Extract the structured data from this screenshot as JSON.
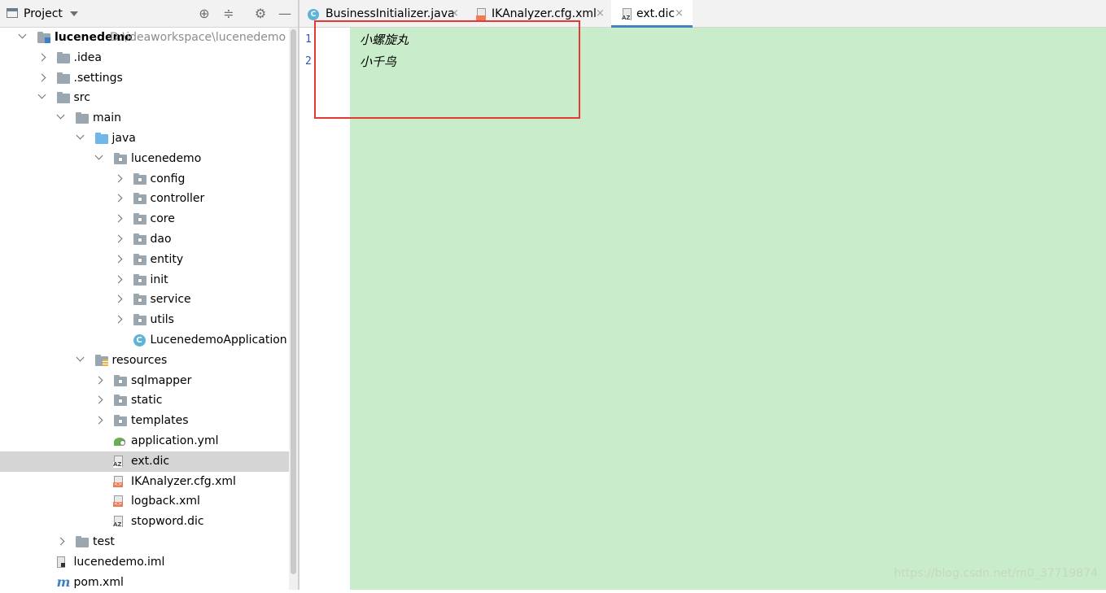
{
  "project_panel": {
    "title": "Project",
    "tree": [
      {
        "label": "lucenedemo",
        "path": "D:\\ideaworkspace\\lucenedemo",
        "depth": 0,
        "arrow": "down",
        "icon": "module-icon",
        "bold": true
      },
      {
        "label": ".idea",
        "depth": 1,
        "arrow": "right",
        "icon": "folder-icon"
      },
      {
        "label": ".settings",
        "depth": 1,
        "arrow": "right",
        "icon": "folder-icon"
      },
      {
        "label": "src",
        "depth": 1,
        "arrow": "down",
        "icon": "folder-icon"
      },
      {
        "label": "main",
        "depth": 2,
        "arrow": "down",
        "icon": "folder-icon"
      },
      {
        "label": "java",
        "depth": 3,
        "arrow": "down",
        "icon": "source-folder-icon"
      },
      {
        "label": "lucenedemo",
        "depth": 4,
        "arrow": "down",
        "icon": "package-icon"
      },
      {
        "label": "config",
        "depth": 5,
        "arrow": "right",
        "icon": "package-icon"
      },
      {
        "label": "controller",
        "depth": 5,
        "arrow": "right",
        "icon": "package-icon"
      },
      {
        "label": "core",
        "depth": 5,
        "arrow": "right",
        "icon": "package-icon"
      },
      {
        "label": "dao",
        "depth": 5,
        "arrow": "right",
        "icon": "package-icon"
      },
      {
        "label": "entity",
        "depth": 5,
        "arrow": "right",
        "icon": "package-icon"
      },
      {
        "label": "init",
        "depth": 5,
        "arrow": "right",
        "icon": "package-icon"
      },
      {
        "label": "service",
        "depth": 5,
        "arrow": "right",
        "icon": "package-icon"
      },
      {
        "label": "utils",
        "depth": 5,
        "arrow": "right",
        "icon": "package-icon"
      },
      {
        "label": "LucenedemoApplication",
        "depth": 5,
        "arrow": "none",
        "icon": "spring-class-icon"
      },
      {
        "label": "resources",
        "depth": 3,
        "arrow": "down",
        "icon": "resources-folder-icon"
      },
      {
        "label": "sqlmapper",
        "depth": 4,
        "arrow": "right",
        "icon": "package-icon"
      },
      {
        "label": "static",
        "depth": 4,
        "arrow": "right",
        "icon": "package-icon"
      },
      {
        "label": "templates",
        "depth": 4,
        "arrow": "right",
        "icon": "package-icon"
      },
      {
        "label": "application.yml",
        "depth": 4,
        "arrow": "none",
        "icon": "spring-config-icon"
      },
      {
        "label": "ext.dic",
        "depth": 4,
        "arrow": "none",
        "icon": "text-file-icon",
        "selected": true
      },
      {
        "label": "IKAnalyzer.cfg.xml",
        "depth": 4,
        "arrow": "none",
        "icon": "xml-file-icon"
      },
      {
        "label": "logback.xml",
        "depth": 4,
        "arrow": "none",
        "icon": "xml-file-icon"
      },
      {
        "label": "stopword.dic",
        "depth": 4,
        "arrow": "none",
        "icon": "text-file-icon"
      },
      {
        "label": "test",
        "depth": 2,
        "arrow": "right",
        "icon": "folder-icon"
      },
      {
        "label": "lucenedemo.iml",
        "depth": 1,
        "arrow": "none",
        "icon": "iml-file-icon"
      },
      {
        "label": "pom.xml",
        "depth": 1,
        "arrow": "none",
        "icon": "maven-icon"
      }
    ]
  },
  "tabs": [
    {
      "label": "BusinessInitializer.java",
      "icon": "java-class-icon",
      "active": false,
      "close": "×"
    },
    {
      "label": "IKAnalyzer.cfg.xml",
      "icon": "xml-file-icon",
      "active": false,
      "close": "×"
    },
    {
      "label": "ext.dic",
      "icon": "text-file-icon",
      "active": true,
      "close": "×"
    }
  ],
  "editor": {
    "lines": [
      {
        "number": "1",
        "text": "小螺旋丸"
      },
      {
        "number": "2",
        "text": "小千鸟"
      }
    ],
    "background_color": "#c9ecca",
    "highlight_color": "#e53935"
  },
  "watermark": "https://blog.csdn.net/m0_37719874"
}
